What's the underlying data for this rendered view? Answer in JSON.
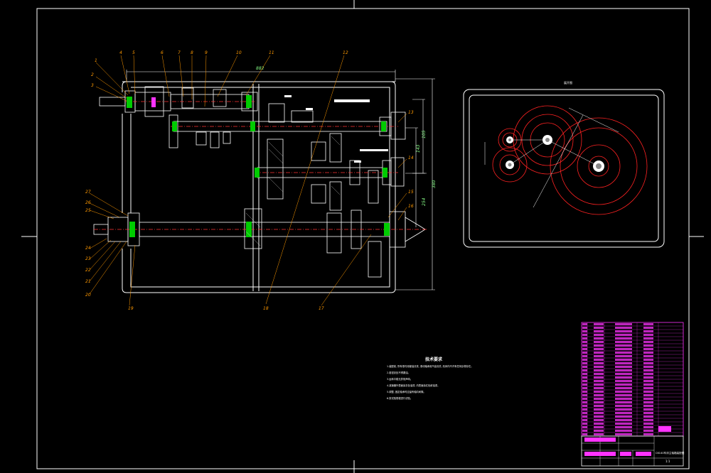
{
  "drawing": {
    "tech_req_title": "技术要求",
    "tech_req_lines": [
      "1.装配前, 所有零件用煤油清洗, 滚动轴承用汽油清洗, 机体内不许有任何杂物存在。",
      "2.各密封处不得漏油。",
      "3.运转平稳无异常声响。",
      "4.减速器外表面涂灰色油漆, 内表面涂红色耐油漆。",
      "5.调整, 固定轴承时应留有轴向间隙。",
      "6.按试验规程进行试验。"
    ],
    "part_numbers_top": [
      "1",
      "2",
      "3",
      "4",
      "5",
      "6",
      "7",
      "8",
      "9",
      "10",
      "11",
      "12"
    ],
    "part_numbers_left": [
      "27",
      "26",
      "25",
      "24",
      "23",
      "22",
      "21",
      "20"
    ],
    "part_numbers_bottom": [
      "18",
      "17"
    ],
    "part_numbers_right": [
      "13",
      "14",
      "15",
      "16"
    ],
    "view_title": "展开图",
    "title_block": {
      "name": "C6140车床主轴箱装配图",
      "scale": "1:1"
    }
  }
}
